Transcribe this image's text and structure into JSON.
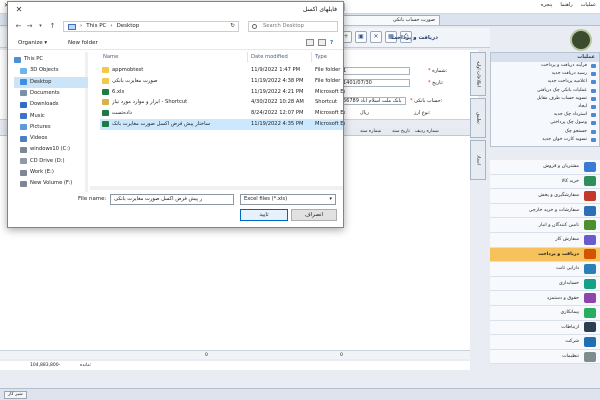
{
  "app": {
    "menu": [
      "عملیات",
      "راهنما",
      "پنجره"
    ],
    "search_placeholder": "جستجو... (Ctrl+=)",
    "tab_label": "صورت حساب بانکی",
    "doc_title": "دریافت و پرداخت",
    "form": {
      "number_label": "شماره:",
      "number_value": "1",
      "date_label": "تاریخ:",
      "date_value": "1401/07/30",
      "account_label": "حساب بانکی:",
      "account_value": "بانک ملت اسلام آباد 56789",
      "type_label": "نوع ارز:",
      "type_value": "ریال"
    },
    "vertical_tabs": [
      "اطلاعات اولیه",
      "تطبیق",
      "اسناد"
    ],
    "grid_headers": [
      "شماره ردیف",
      "تاریخ سند",
      "شماره سند"
    ],
    "totals": {
      "left_value": "0",
      "mid_value": "0"
    },
    "status": {
      "balance": "104,883,800-",
      "balance_label": "مانده:"
    },
    "ops_panel": {
      "title": "عملیات",
      "items": [
        "فرآیند دریافت و پرداخت",
        "رسید دریافت جدید",
        "اعلامیه پرداخت جدید",
        "عملیات بانکی چک دریافتی",
        "تسویه حساب طرف مقابل",
        "ایجاد",
        "استرداد چک جدید",
        "وصول چک پرداختی",
        "جستجو چک",
        "تسویه کارت خوان جدید"
      ]
    },
    "modules": [
      {
        "label": "مشتریان و فروش",
        "color": "#3a7bd5",
        "active": false
      },
      {
        "label": "خرید کالا",
        "color": "#2f8f5b",
        "active": false
      },
      {
        "label": "سفارشگیری و پخش",
        "color": "#c0392b",
        "active": false
      },
      {
        "label": "سفارشات و خرید خارجی",
        "color": "#2c6fb7",
        "active": false
      },
      {
        "label": "تامین کنندگان و انبار",
        "color": "#4b8f2f",
        "active": false
      },
      {
        "label": "سفارش کار",
        "color": "#6a5acd",
        "active": false
      },
      {
        "label": "دریافت و پرداخت",
        "color": "#d35400",
        "active": true
      },
      {
        "label": "دارایی ثابت",
        "color": "#2980b9",
        "active": false
      },
      {
        "label": "حسابداری",
        "color": "#16a085",
        "active": false
      },
      {
        "label": "حقوق و دستمزد",
        "color": "#8e44ad",
        "active": false
      },
      {
        "label": "پیمانکاری",
        "color": "#27ae60",
        "active": false
      },
      {
        "label": "ارتباطات",
        "color": "#2c3e50",
        "active": false
      },
      {
        "label": "شرکت",
        "color": "#1f6fb2",
        "active": false
      },
      {
        "label": "تنظیمات",
        "color": "#7f8c8d",
        "active": false
      }
    ],
    "taskbar_button": "شیر کار"
  },
  "dialog": {
    "title": "فایلهای اکسل",
    "address": [
      "This PC",
      "Desktop"
    ],
    "search_placeholder": "Search Desktop",
    "organize": "Organize ▾",
    "new_folder": "New folder",
    "nav_items": [
      {
        "label": "This PC",
        "color": "#4f8ed9",
        "selected": false
      },
      {
        "label": "3D Objects",
        "color": "#6fb4e9",
        "selected": false
      },
      {
        "label": "Desktop",
        "color": "#3c8fe0",
        "selected": true
      },
      {
        "label": "Documents",
        "color": "#7a8fa8",
        "selected": false
      },
      {
        "label": "Downloads",
        "color": "#2d6fc4",
        "selected": false
      },
      {
        "label": "Music",
        "color": "#3d74c9",
        "selected": false
      },
      {
        "label": "Pictures",
        "color": "#5c9bd6",
        "selected": false
      },
      {
        "label": "Videos",
        "color": "#4a7fc0",
        "selected": false
      },
      {
        "label": "windows10 (C:)",
        "color": "#7b8794",
        "selected": false
      },
      {
        "label": "CD Drive (D:)",
        "color": "#909aa6",
        "selected": false
      },
      {
        "label": "Work (E:)",
        "color": "#7b8794",
        "selected": false
      },
      {
        "label": "New Volume (F:)",
        "color": "#7b8794",
        "selected": false
      }
    ],
    "columns": {
      "name": "Name",
      "date": "Date modified",
      "type": "Type"
    },
    "files": [
      {
        "name": "appmobtest",
        "date": "11/9/2022 1:47 PM",
        "type": "File folder",
        "icon_color": "#f2c94c",
        "selected": false
      },
      {
        "name": "صورت مغایرت بانکی",
        "date": "11/19/2022 4:38 PM",
        "type": "File folder",
        "icon_color": "#f2c94c",
        "selected": false
      },
      {
        "name": "6.xls",
        "date": "11/19/2022 4:21 PM",
        "type": "Microsoft Ex",
        "icon_color": "#1e7b45",
        "selected": false
      },
      {
        "name": "ابزار و موارد مورد نیاز - Shortcut",
        "date": "4/30/2022 10:28 AM",
        "type": "Shortcut",
        "icon_color": "#d9b14a",
        "selected": false
      },
      {
        "name": "داده‌تست",
        "date": "8/24/2022 12:07 PM",
        "type": "Microsoft Ex",
        "icon_color": "#1e7b45",
        "selected": false
      },
      {
        "name": "ساختار پیش فرض اکسل صورت مغایرت بانک",
        "date": "11/19/2022 4:35 PM",
        "type": "Microsoft Ex",
        "icon_color": "#1e7b45",
        "selected": true
      }
    ],
    "file_name_label": "File name:",
    "file_name_value": "ر پیش فرض اکسل صورت مغایرت بانکی",
    "file_type": "Excel files (*.xls)",
    "open": "تایید",
    "cancel": "انصراف"
  },
  "colors": {
    "accent": "#0067c0",
    "selection": "#cce8ff",
    "active_module": "#f5c25c"
  }
}
